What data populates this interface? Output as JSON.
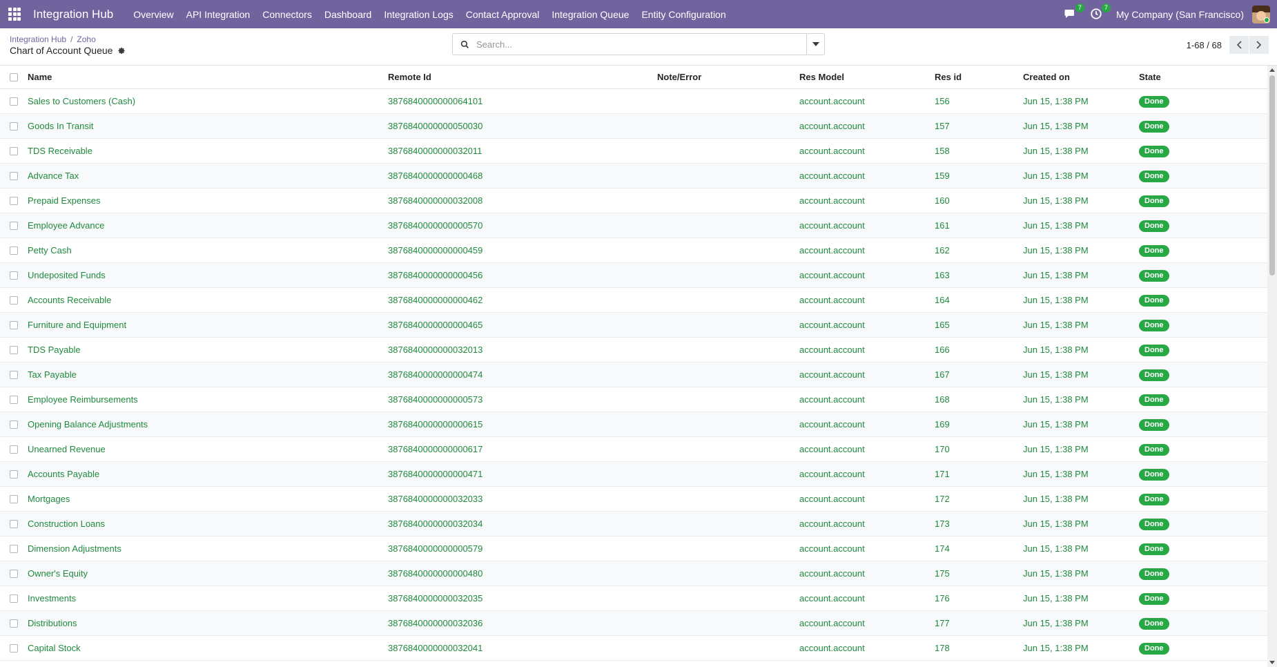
{
  "navbar": {
    "brand": "Integration Hub",
    "menu": [
      {
        "label": "Overview",
        "name": "menu-overview"
      },
      {
        "label": "API Integration",
        "name": "menu-api-integration"
      },
      {
        "label": "Connectors",
        "name": "menu-connectors"
      },
      {
        "label": "Dashboard",
        "name": "menu-dashboard"
      },
      {
        "label": "Integration Logs",
        "name": "menu-integration-logs"
      },
      {
        "label": "Contact Approval",
        "name": "menu-contact-approval"
      },
      {
        "label": "Integration Queue",
        "name": "menu-integration-queue"
      },
      {
        "label": "Entity Configuration",
        "name": "menu-entity-configuration"
      }
    ],
    "messages_count": "7",
    "activities_count": "7",
    "company": "My Company (San Francisco)"
  },
  "breadcrumb": {
    "parent": "Integration Hub",
    "separator": "/",
    "current": "Zoho"
  },
  "page_title": "Chart of Account Queue",
  "search": {
    "placeholder": "Search..."
  },
  "pager": {
    "value": "1-68 / 68"
  },
  "columns": {
    "name": "Name",
    "remote_id": "Remote Id",
    "note": "Note/Error",
    "res_model": "Res Model",
    "res_id": "Res id",
    "created_on": "Created on",
    "state": "State"
  },
  "rows": [
    {
      "name": "Sales to Customers (Cash)",
      "remote_id": "3876840000000064101",
      "note": "",
      "res_model": "account.account",
      "res_id": "156",
      "created_on": "Jun 15, 1:38 PM",
      "state": "Done"
    },
    {
      "name": "Goods In Transit",
      "remote_id": "3876840000000050030",
      "note": "",
      "res_model": "account.account",
      "res_id": "157",
      "created_on": "Jun 15, 1:38 PM",
      "state": "Done"
    },
    {
      "name": "TDS Receivable",
      "remote_id": "3876840000000032011",
      "note": "",
      "res_model": "account.account",
      "res_id": "158",
      "created_on": "Jun 15, 1:38 PM",
      "state": "Done"
    },
    {
      "name": "Advance Tax",
      "remote_id": "3876840000000000468",
      "note": "",
      "res_model": "account.account",
      "res_id": "159",
      "created_on": "Jun 15, 1:38 PM",
      "state": "Done"
    },
    {
      "name": "Prepaid Expenses",
      "remote_id": "3876840000000032008",
      "note": "",
      "res_model": "account.account",
      "res_id": "160",
      "created_on": "Jun 15, 1:38 PM",
      "state": "Done"
    },
    {
      "name": "Employee Advance",
      "remote_id": "3876840000000000570",
      "note": "",
      "res_model": "account.account",
      "res_id": "161",
      "created_on": "Jun 15, 1:38 PM",
      "state": "Done"
    },
    {
      "name": "Petty Cash",
      "remote_id": "3876840000000000459",
      "note": "",
      "res_model": "account.account",
      "res_id": "162",
      "created_on": "Jun 15, 1:38 PM",
      "state": "Done"
    },
    {
      "name": "Undeposited Funds",
      "remote_id": "3876840000000000456",
      "note": "",
      "res_model": "account.account",
      "res_id": "163",
      "created_on": "Jun 15, 1:38 PM",
      "state": "Done"
    },
    {
      "name": "Accounts Receivable",
      "remote_id": "3876840000000000462",
      "note": "",
      "res_model": "account.account",
      "res_id": "164",
      "created_on": "Jun 15, 1:38 PM",
      "state": "Done"
    },
    {
      "name": "Furniture and Equipment",
      "remote_id": "3876840000000000465",
      "note": "",
      "res_model": "account.account",
      "res_id": "165",
      "created_on": "Jun 15, 1:38 PM",
      "state": "Done"
    },
    {
      "name": "TDS Payable",
      "remote_id": "3876840000000032013",
      "note": "",
      "res_model": "account.account",
      "res_id": "166",
      "created_on": "Jun 15, 1:38 PM",
      "state": "Done"
    },
    {
      "name": "Tax Payable",
      "remote_id": "3876840000000000474",
      "note": "",
      "res_model": "account.account",
      "res_id": "167",
      "created_on": "Jun 15, 1:38 PM",
      "state": "Done"
    },
    {
      "name": "Employee Reimbursements",
      "remote_id": "3876840000000000573",
      "note": "",
      "res_model": "account.account",
      "res_id": "168",
      "created_on": "Jun 15, 1:38 PM",
      "state": "Done"
    },
    {
      "name": "Opening Balance Adjustments",
      "remote_id": "3876840000000000615",
      "note": "",
      "res_model": "account.account",
      "res_id": "169",
      "created_on": "Jun 15, 1:38 PM",
      "state": "Done"
    },
    {
      "name": "Unearned Revenue",
      "remote_id": "3876840000000000617",
      "note": "",
      "res_model": "account.account",
      "res_id": "170",
      "created_on": "Jun 15, 1:38 PM",
      "state": "Done"
    },
    {
      "name": "Accounts Payable",
      "remote_id": "3876840000000000471",
      "note": "",
      "res_model": "account.account",
      "res_id": "171",
      "created_on": "Jun 15, 1:38 PM",
      "state": "Done"
    },
    {
      "name": "Mortgages",
      "remote_id": "3876840000000032033",
      "note": "",
      "res_model": "account.account",
      "res_id": "172",
      "created_on": "Jun 15, 1:38 PM",
      "state": "Done"
    },
    {
      "name": "Construction Loans",
      "remote_id": "3876840000000032034",
      "note": "",
      "res_model": "account.account",
      "res_id": "173",
      "created_on": "Jun 15, 1:38 PM",
      "state": "Done"
    },
    {
      "name": "Dimension Adjustments",
      "remote_id": "3876840000000000579",
      "note": "",
      "res_model": "account.account",
      "res_id": "174",
      "created_on": "Jun 15, 1:38 PM",
      "state": "Done"
    },
    {
      "name": "Owner's Equity",
      "remote_id": "3876840000000000480",
      "note": "",
      "res_model": "account.account",
      "res_id": "175",
      "created_on": "Jun 15, 1:38 PM",
      "state": "Done"
    },
    {
      "name": "Investments",
      "remote_id": "3876840000000032035",
      "note": "",
      "res_model": "account.account",
      "res_id": "176",
      "created_on": "Jun 15, 1:38 PM",
      "state": "Done"
    },
    {
      "name": "Distributions",
      "remote_id": "3876840000000032036",
      "note": "",
      "res_model": "account.account",
      "res_id": "177",
      "created_on": "Jun 15, 1:38 PM",
      "state": "Done"
    },
    {
      "name": "Capital Stock",
      "remote_id": "3876840000000032041",
      "note": "",
      "res_model": "account.account",
      "res_id": "178",
      "created_on": "Jun 15, 1:38 PM",
      "state": "Done"
    }
  ],
  "colors": {
    "navbar": "#71639e",
    "link_green": "#1f8a3d",
    "badge_done": "#28a745"
  },
  "icons": {
    "apps": "apps-grid-icon",
    "messages": "chat-icon",
    "activities": "clock-icon",
    "settings": "gear-icon",
    "search": "search-icon",
    "search_toggle": "caret-down-icon",
    "pager_prev": "chevron-left-icon",
    "pager_next": "chevron-right-icon"
  }
}
